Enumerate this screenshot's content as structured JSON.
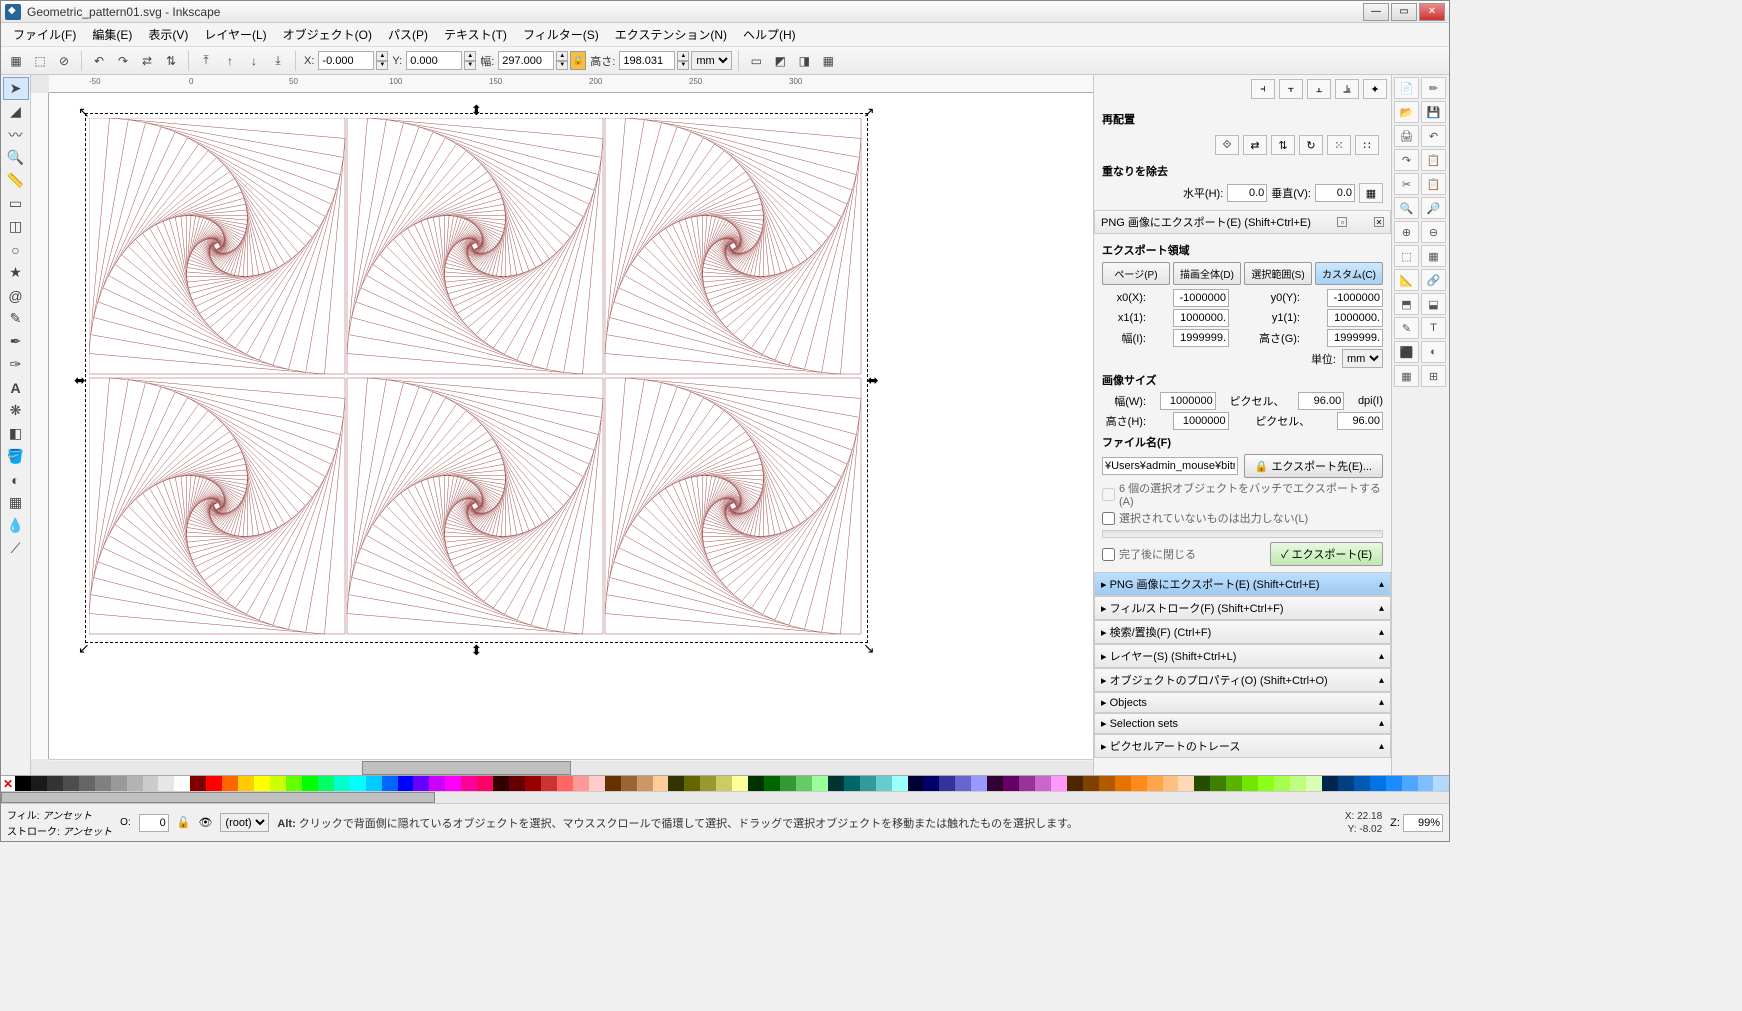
{
  "title": "Geometric_pattern01.svg - Inkscape",
  "menu": [
    "ファイル(F)",
    "編集(E)",
    "表示(V)",
    "レイヤー(L)",
    "オブジェクト(O)",
    "パス(P)",
    "テキスト(T)",
    "フィルター(S)",
    "エクステンション(N)",
    "ヘルプ(H)"
  ],
  "toolbar": {
    "x_label": "X:",
    "x_val": "-0.000",
    "y_label": "Y:",
    "y_val": "0.000",
    "w_label": "幅:",
    "w_val": "297.000",
    "h_label": "高さ:",
    "h_val": "198.031",
    "unit": "mm"
  },
  "ruler_marks": [
    "-50",
    "0",
    "50",
    "100",
    "150",
    "200",
    "250",
    "300"
  ],
  "dock": {
    "rearrange": "再配置",
    "remove_overlap": "重なりを除去",
    "horiz_label": "水平(H):",
    "horiz_val": "0.0",
    "vert_label": "垂直(V):",
    "vert_val": "0.0",
    "export_header": "PNG 画像にエクスポート(E) (Shift+Ctrl+E)",
    "export_area": "エクスポート領域",
    "tabs": [
      "ページ(P)",
      "描画全体(D)",
      "選択範囲(S)",
      "カスタム(C)"
    ],
    "x0_label": "x0(X):",
    "x0_val": "-1000000",
    "y0_label": "y0(Y):",
    "y0_val": "-1000000",
    "x1_label": "x1(1):",
    "x1_val": "1000000.",
    "y1_label": "y1(1):",
    "y1_val": "1000000.",
    "w2_label": "幅(I):",
    "w2_val": "1999999.",
    "h2_label": "高さ(G):",
    "h2_val": "1999999.",
    "unit_label": "単位:",
    "unit_val": "mm",
    "image_size": "画像サイズ",
    "img_w_label": "幅(W):",
    "img_w_val": "1000000",
    "pixels": "ピクセル、",
    "dpi_label": "dpi(I)",
    "img_h_label": "高さ(H):",
    "img_h_val": "1000000",
    "dpi_val": "96.00",
    "filename_label": "ファイル名(F)",
    "filename": "¥Users¥admin_mouse¥bitmap.png",
    "export_to": "エクスポート先(E)...",
    "batch_check": "6 個の選択オブジェクトをバッチでエクスポートする(A)",
    "hide_check": "選択されていないものは出力しない(L)",
    "close_check": "完了後に閉じる",
    "export_btn": "エクスポート(E)",
    "collapsed": [
      "PNG 画像にエクスポート(E) (Shift+Ctrl+E)",
      "フィル/ストローク(F) (Shift+Ctrl+F)",
      "検索/置換(F) (Ctrl+F)",
      "レイヤー(S) (Shift+Ctrl+L)",
      "オブジェクトのプロパティ(O) (Shift+Ctrl+O)",
      "Objects",
      "Selection sets",
      "ピクセルアートのトレース"
    ]
  },
  "status": {
    "fill_label": "フィル:",
    "fill_val": "アンセット",
    "stroke_label": "ストローク:",
    "stroke_val": "アンセット",
    "opacity": "0",
    "layer": "(root)",
    "hint_prefix": "Alt:",
    "hint": "クリックで背面側に隠れているオブジェクトを選択、マウススクロールで循環して選択、ドラッグで選択オブジェクトを移動または触れたものを選択します。",
    "x_lbl": "X:",
    "x": "22.18",
    "y_lbl": "Y:",
    "y": "-8.02",
    "z_lbl": "Z:",
    "z": "99%"
  },
  "palette_colors": [
    "#000000",
    "#1a1a1a",
    "#333333",
    "#4d4d4d",
    "#666666",
    "#808080",
    "#999999",
    "#b3b3b3",
    "#cccccc",
    "#e6e6e6",
    "#ffffff",
    "#800000",
    "#ff0000",
    "#ff6600",
    "#ffcc00",
    "#ffff00",
    "#ccff00",
    "#66ff00",
    "#00ff00",
    "#00ff66",
    "#00ffcc",
    "#00ffff",
    "#00ccff",
    "#0066ff",
    "#0000ff",
    "#6600ff",
    "#cc00ff",
    "#ff00ff",
    "#ff0099",
    "#ff0066",
    "#330000",
    "#660000",
    "#990000",
    "#cc3333",
    "#ff6666",
    "#ff9999",
    "#ffcccc",
    "#663300",
    "#996633",
    "#cc9966",
    "#ffcc99",
    "#333300",
    "#666600",
    "#999933",
    "#cccc66",
    "#ffff99",
    "#003300",
    "#006600",
    "#339933",
    "#66cc66",
    "#99ff99",
    "#003333",
    "#006666",
    "#339999",
    "#66cccc",
    "#99ffff",
    "#000033",
    "#000066",
    "#333399",
    "#6666cc",
    "#9999ff",
    "#330033",
    "#660066",
    "#993399",
    "#cc66cc",
    "#ff99ff",
    "#4d2600",
    "#804000",
    "#b35900",
    "#e67300",
    "#ff8c1a",
    "#ffa64d",
    "#ffbf80",
    "#ffd9b3",
    "#264d00",
    "#408000",
    "#59b300",
    "#73e600",
    "#8cff1a",
    "#a6ff4d",
    "#bfff80",
    "#d9ffb3",
    "#00264d",
    "#004080",
    "#0059b3",
    "#0073e6",
    "#1a8cff",
    "#4da6ff",
    "#80bfff",
    "#b3d9ff"
  ]
}
